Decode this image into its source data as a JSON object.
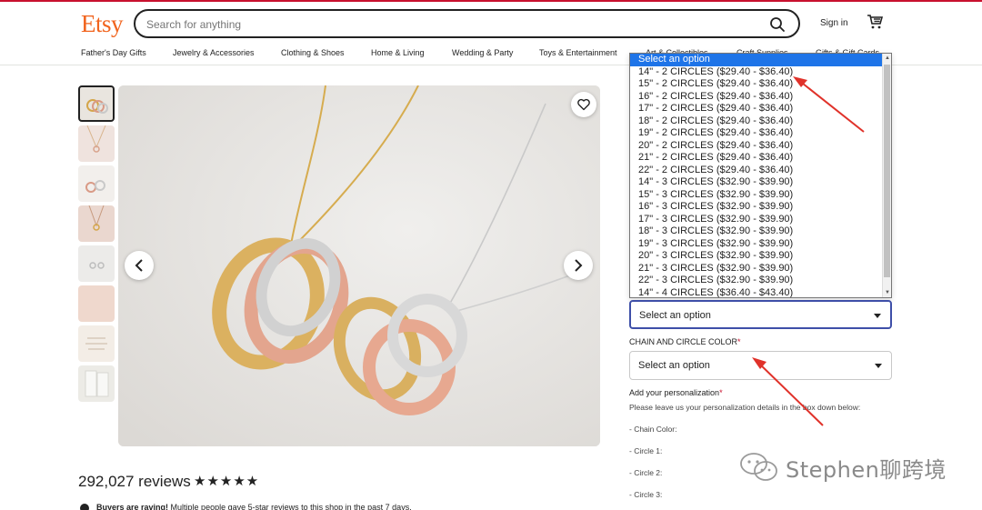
{
  "header": {
    "logo": "Etsy",
    "search_placeholder": "Search for anything",
    "sign_in": "Sign in",
    "cart_icon": "cart-icon"
  },
  "nav": [
    "Father's Day Gifts",
    "Jewelry & Accessories",
    "Clothing & Shoes",
    "Home & Living",
    "Wedding & Party",
    "Toys & Entertainment",
    "Art & Collectibles",
    "Craft Supplies",
    "Gifts & Gift Cards"
  ],
  "reviews": {
    "count": "292,027 reviews",
    "stars": "★★★★★",
    "buyers_bold": "Buyers are raving!",
    "buyers_text": " Multiple people gave 5-star reviews to this shop in the past 7 days."
  },
  "dropdown": {
    "options": [
      "Select an option",
      "14\" - 2 CIRCLES ($29.40 - $36.40)",
      "15\" - 2 CIRCLES ($29.40 - $36.40)",
      "16\" - 2 CIRCLES ($29.40 - $36.40)",
      "17\" - 2 CIRCLES ($29.40 - $36.40)",
      "18\" - 2 CIRCLES ($29.40 - $36.40)",
      "19\" - 2 CIRCLES ($29.40 - $36.40)",
      "20\" - 2 CIRCLES ($29.40 - $36.40)",
      "21\" - 2 CIRCLES ($29.40 - $36.40)",
      "22\" - 2 CIRCLES ($29.40 - $36.40)",
      "14\" - 3 CIRCLES ($32.90 - $39.90)",
      "15\" - 3 CIRCLES ($32.90 - $39.90)",
      "16\" - 3 CIRCLES ($32.90 - $39.90)",
      "17\" - 3 CIRCLES ($32.90 - $39.90)",
      "18\" - 3 CIRCLES ($32.90 - $39.90)",
      "19\" - 3 CIRCLES ($32.90 - $39.90)",
      "20\" - 3 CIRCLES ($32.90 - $39.90)",
      "21\" - 3 CIRCLES ($32.90 - $39.90)",
      "22\" - 3 CIRCLES ($32.90 - $39.90)",
      "14\" - 4 CIRCLES ($36.40 - $43.40)"
    ],
    "highlighted_index": 0
  },
  "length_select": {
    "value": "Select an option"
  },
  "color_select": {
    "label": "CHAIN AND CIRCLE COLOR",
    "required": "*",
    "value": "Select an option"
  },
  "personalization": {
    "label": "Add your personalization",
    "required": "*",
    "instructions": "Please leave us your personalization details in the box down below:",
    "lines": [
      "- Chain Color:",
      "- Circle 1:",
      "- Circle 2:",
      "- Circle 3:"
    ]
  },
  "watermark": {
    "text": "Stephen聊跨境"
  },
  "colors": {
    "etsy_orange": "#f1641e",
    "annotation_red": "#e0322a",
    "highlight_blue": "#1e74e8"
  }
}
